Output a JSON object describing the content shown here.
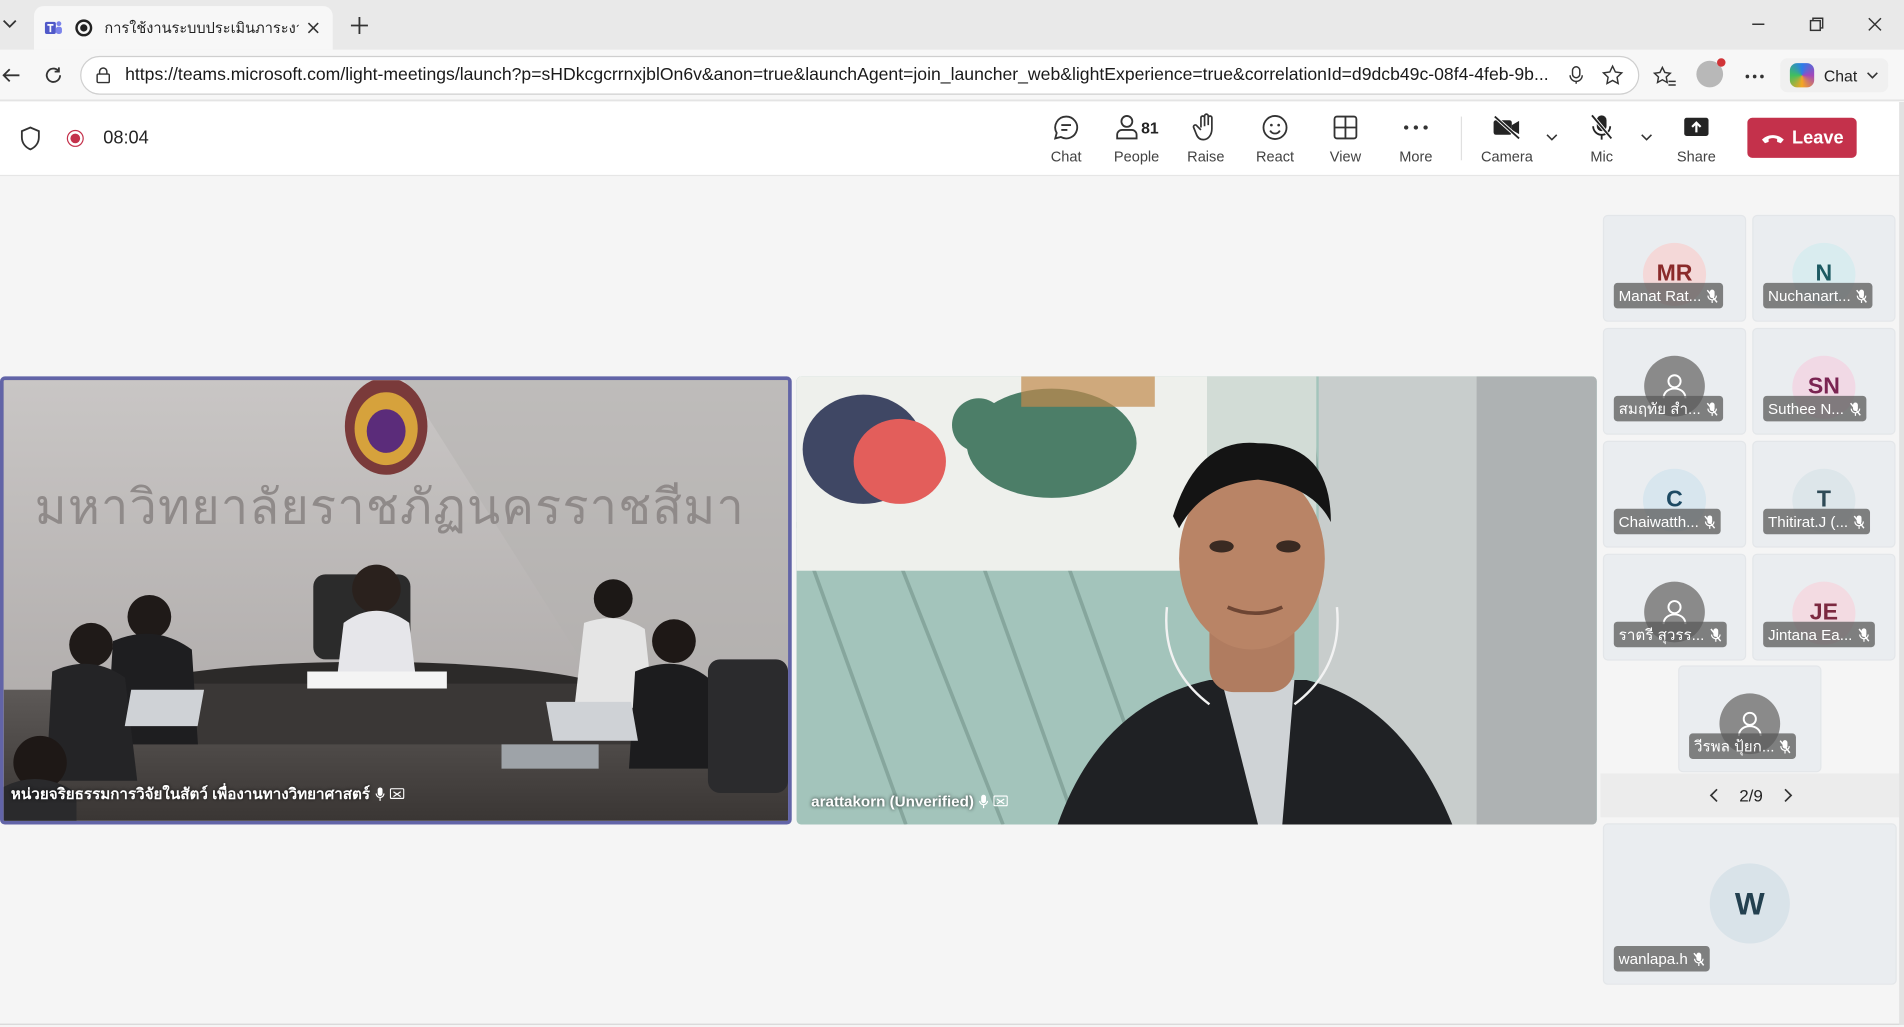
{
  "browser": {
    "tab_title": "การใช้งานระบบประเมินภาระงาน พนักงาน",
    "url": "https://teams.microsoft.com/light-meetings/launch?p=sHDkcgcrrnxjblOn6v&anon=true&launchAgent=join_launcher_web&lightExperience=true&correlationId=d9dcb49c-08f4-4feb-9b...",
    "copilot_label": "Chat"
  },
  "meeting": {
    "timer": "08:04",
    "buttons": {
      "chat": "Chat",
      "people": "People",
      "people_count": "81",
      "raise": "Raise",
      "react": "React",
      "view": "View",
      "more": "More",
      "camera": "Camera",
      "mic": "Mic",
      "share": "Share",
      "leave": "Leave"
    },
    "colors": {
      "leave": "#c4314b",
      "active_border": "#6264a7",
      "recording": "#c4314b"
    }
  },
  "stage": {
    "left_name": "หน่วยจริยธรรมการวิจัยในสัตว์ เพื่องานทางวิทยาศาสตร์",
    "left_sign_text": "มหาวิทยาลัยราชภัฏนครราชสีมา",
    "right_name": "arattakorn (Unverified)"
  },
  "gallery": {
    "tiles": [
      {
        "initials": "MR",
        "name": "Manat Rat...",
        "avatar_color": "#f4d8d8",
        "text_color": "#8a2a2a"
      },
      {
        "initials": "N",
        "name": "Nuchanart...",
        "avatar_color": "#d9ecef",
        "text_color": "#1c5a62"
      },
      {
        "initials": "",
        "name": "สมฤทัย สำ...",
        "avatar": "person-icon"
      },
      {
        "initials": "SN",
        "name": "Suthee N...",
        "avatar_color": "#f1d9e5",
        "text_color": "#7a2452"
      },
      {
        "initials": "C",
        "name": "Chaiwatth...",
        "avatar_color": "#d8e6ee",
        "text_color": "#1d4a63"
      },
      {
        "initials": "T",
        "name": "Thitirat.J (...",
        "avatar_color": "#dde6ea",
        "text_color": "#2e4a56"
      },
      {
        "initials": "",
        "name": "ราตรี สุวรร...",
        "avatar": "person-icon"
      },
      {
        "initials": "JE",
        "name": "Jintana Ea...",
        "avatar_color": "#f3dbe2",
        "text_color": "#7c2940"
      },
      {
        "initials": "",
        "name": "วีรพล ปุ้ยก...",
        "avatar": "person-icon"
      }
    ],
    "page": "2/9",
    "big_tile": {
      "initials": "W",
      "name": "wanlapa.h"
    }
  }
}
